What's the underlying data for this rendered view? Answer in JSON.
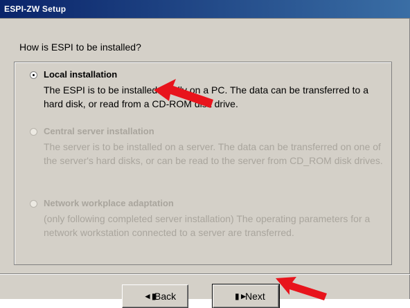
{
  "window": {
    "title": "ESPI-ZW Setup"
  },
  "question": "How is ESPI to be installed?",
  "options": [
    {
      "label": "Local installation",
      "description": "The ESPI is to be installed locally on a PC. The data can be transferred to a hard disk, or read from a CD-ROM disk drive.",
      "selected": true,
      "enabled": true
    },
    {
      "label": "Central server installation",
      "description": "The server is to be installed on a server. The data can be transferred on one of the server's hard disks, or can be read to the server from CD_ROM disk drives.",
      "selected": false,
      "enabled": false
    },
    {
      "label": "Network workplace adaptation",
      "description": "(only following completed server installation) The operating parameters for a network workstation connected to a server are transferred.",
      "selected": false,
      "enabled": false
    }
  ],
  "buttons": {
    "back": "Back",
    "next": "Next"
  },
  "icons": {
    "back": "back-arrow-icon",
    "next": "next-arrow-icon",
    "annotation": "red-arrow-icon"
  },
  "colors": {
    "titlebar": "#0a246a",
    "face": "#d4d0c8",
    "annotation": "#e8141c",
    "disabled_text": "#a9a59d"
  }
}
